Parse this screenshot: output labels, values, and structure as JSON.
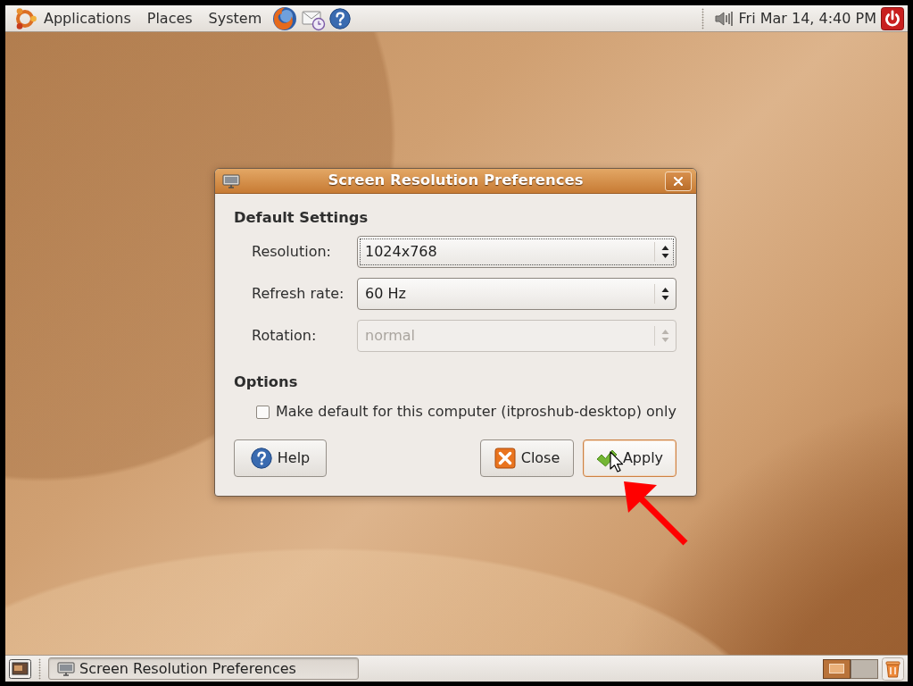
{
  "top_panel": {
    "menus": [
      {
        "label": "Applications"
      },
      {
        "label": "Places"
      },
      {
        "label": "System"
      }
    ],
    "clock": "Fri Mar 14, 4:40 PM"
  },
  "dialog": {
    "title": "Screen Resolution Preferences",
    "default_settings": {
      "heading": "Default Settings",
      "fields": [
        {
          "label": "Resolution:",
          "value": "1024x768",
          "focused": true,
          "disabled": false
        },
        {
          "label": "Refresh rate:",
          "value": "60 Hz",
          "focused": false,
          "disabled": false
        },
        {
          "label": "Rotation:",
          "value": "normal",
          "focused": false,
          "disabled": true
        }
      ]
    },
    "options": {
      "heading": "Options",
      "checkbox": {
        "label": "Make default for this computer (itproshub-desktop) only",
        "checked": false
      }
    },
    "buttons": [
      {
        "kind": "help",
        "label": "Help",
        "hovered": false
      },
      {
        "kind": "close",
        "label": "Close",
        "hovered": false
      },
      {
        "kind": "apply",
        "label": "Apply",
        "hovered": true
      }
    ]
  },
  "taskbar": {
    "windows": [
      {
        "title": "Screen Resolution Preferences",
        "selected": true
      }
    ],
    "workspaces": [
      {
        "selected": true
      },
      {
        "selected": false
      }
    ]
  }
}
